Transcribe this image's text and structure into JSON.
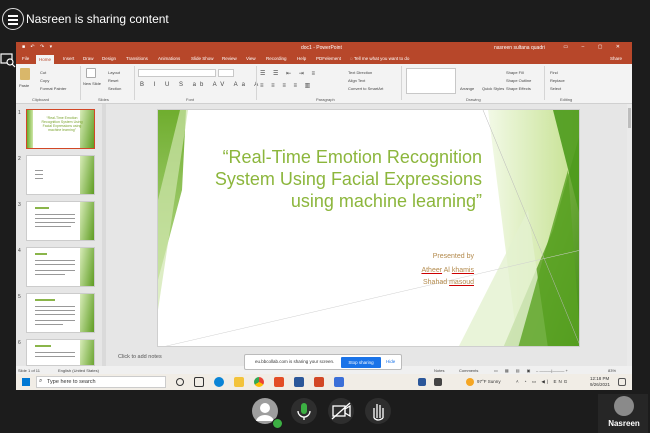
{
  "meeting": {
    "share_title": "Nasreen is sharing content",
    "participant_name": "Nasreen"
  },
  "powerpoint": {
    "doc_title": "doc1 - PowerPoint",
    "user_name": "nasreen sultana quadri",
    "tabs": [
      "File",
      "Home",
      "Insert",
      "Draw",
      "Design",
      "Transitions",
      "Animations",
      "Slide Show",
      "Review",
      "View",
      "Recording",
      "Help",
      "PDFelement"
    ],
    "tell_me": "Tell me what you want to do",
    "share_label": "Share",
    "ribbon": {
      "clipboard": {
        "label": "Clipboard",
        "paste": "Paste",
        "cut": "Cut",
        "copy": "Copy",
        "format_painter": "Format Painter"
      },
      "slides": {
        "label": "Slides",
        "new_slide": "New Slide",
        "layout": "Layout",
        "reset": "Reset",
        "section": "Section"
      },
      "font": {
        "label": "Font"
      },
      "paragraph": {
        "label": "Paragraph",
        "text_direction": "Text Direction",
        "align_text": "Align Text",
        "smartart": "Convert to SmartArt"
      },
      "drawing": {
        "label": "Drawing",
        "arrange": "Arrange",
        "quick_styles": "Quick Styles",
        "shape_fill": "Shape Fill",
        "shape_outline": "Shape Outline",
        "shape_effects": "Shape Effects"
      },
      "editing": {
        "label": "Editing",
        "find": "Find",
        "replace": "Replace",
        "select": "Select"
      }
    },
    "thumbnails": [
      {
        "num": "1",
        "title": "“Real-Time Emotion Recognition System Using Facial Expressions using machine learning”"
      },
      {
        "num": "2"
      },
      {
        "num": "3"
      },
      {
        "num": "4"
      },
      {
        "num": "5"
      },
      {
        "num": "6"
      }
    ],
    "slide": {
      "title": "“Real-Time Emotion Recognition System Using Facial Expressions using  machine learning”",
      "presented_by": "Presented by",
      "author1_first": "Atheer",
      "author1_mid": "Al",
      "author1_last": "khamis",
      "author2_first": "Shahad",
      "author2_last": "masoud"
    },
    "notes_placeholder": "Click to add notes",
    "status": {
      "slide_count": "Slide 1 of 11",
      "language": "English (United States)",
      "notes": "Notes",
      "comments": "Comments",
      "zoom": "83%"
    }
  },
  "share_banner": {
    "text": "eu.bbcollab.com is sharing your screen.",
    "stop": "Stop sharing",
    "hide": "Hide"
  },
  "taskbar": {
    "search_placeholder": "Type here to search",
    "weather": "97°F  Sunny",
    "time": "12:18 PM",
    "date": "9/26/2021"
  },
  "colors": {
    "ppt_accent": "#b7472a",
    "slide_green": "#8cb63c",
    "stop_blue": "#1a73e8",
    "mic_green": "#3cb043"
  }
}
